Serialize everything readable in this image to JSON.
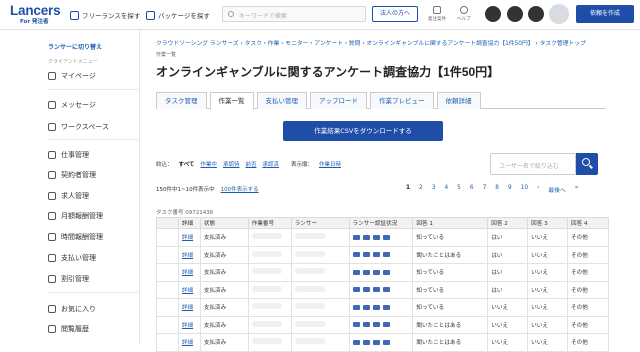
{
  "header": {
    "logo": "Lancers",
    "logo_sub": "For 発注者",
    "nav_freelance": "フリーランスを探す",
    "nav_package": "パッケージを探す",
    "search_placeholder": "キーワードで検索",
    "corp_button": "法人の方へ",
    "icon_order": "発注案件",
    "icon_help": "ヘルプ",
    "create_button": "依頼を作成"
  },
  "sidebar": {
    "switch": "ランサーに切り替え",
    "menu_label": "クライアントメニュー",
    "items": [
      "マイページ",
      "メッセージ",
      "ワークスペース",
      "仕事管理",
      "契約者管理",
      "求人管理",
      "月額報酬管理",
      "時間報酬管理",
      "支払い管理",
      "割引管理",
      "お気に入り",
      "閲覧履歴"
    ]
  },
  "main": {
    "breadcrumb": "クラウドソーシング ランサーズ › タスク・作業 › モニター・アンケート・質問 › オンラインギャンブルに関するアンケート調査協力【1件50円】 › タスク管理トップ",
    "breadcrumb_sub": "作業一覧",
    "title": "オンラインギャンブルに関するアンケート調査協力【1件50円】",
    "tabs": [
      "タスク管理",
      "作業一覧",
      "支払い管理",
      "アップロード",
      "作業プレビュー",
      "依頼詳細"
    ],
    "download_button": "作業結果CSVをダウンロードする",
    "filter_label": "絞込：",
    "filters": [
      "すべて",
      "作業中",
      "承認待",
      "前否",
      "承認済"
    ],
    "display_label": "表示順：",
    "display_option": "作業日時",
    "user_search_placeholder": "ユーザー名で絞り込む",
    "count_text": "150件中1~10件表示中",
    "count_link": "100件表示する",
    "pager": [
      "1",
      "2",
      "3",
      "4",
      "5",
      "6",
      "7",
      "8",
      "9",
      "10",
      "›",
      "最後へ",
      "»"
    ],
    "task_number": "タスク番号 09721436",
    "columns": [
      "",
      "詳細",
      "状態",
      "作業番号",
      "ランサー",
      "ランサー認証状況",
      "回答 1",
      "回答 2",
      "回答 3",
      "回答 4"
    ],
    "rows": [
      {
        "detail": "詳細",
        "status": "支払済み",
        "a1": "知っている",
        "a2": "はい",
        "a3": "いいえ",
        "a4": "その他"
      },
      {
        "detail": "詳細",
        "status": "支払済み",
        "a1": "聞いたことはある",
        "a2": "はい",
        "a3": "いいえ",
        "a4": "その他"
      },
      {
        "detail": "詳細",
        "status": "支払済み",
        "a1": "知っている",
        "a2": "はい",
        "a3": "いいえ",
        "a4": "その他"
      },
      {
        "detail": "詳細",
        "status": "支払済み",
        "a1": "知っている",
        "a2": "はい",
        "a3": "いいえ",
        "a4": "その他"
      },
      {
        "detail": "詳細",
        "status": "支払済み",
        "a1": "知っている",
        "a2": "いいえ",
        "a3": "いいえ",
        "a4": "その他"
      },
      {
        "detail": "詳細",
        "status": "支払済み",
        "a1": "聞いたことはある",
        "a2": "いいえ",
        "a3": "いいえ",
        "a4": "その他"
      },
      {
        "detail": "詳細",
        "status": "支払済み",
        "a1": "聞いたことはある",
        "a2": "いいえ",
        "a3": "いいえ",
        "a4": "その他"
      }
    ]
  }
}
